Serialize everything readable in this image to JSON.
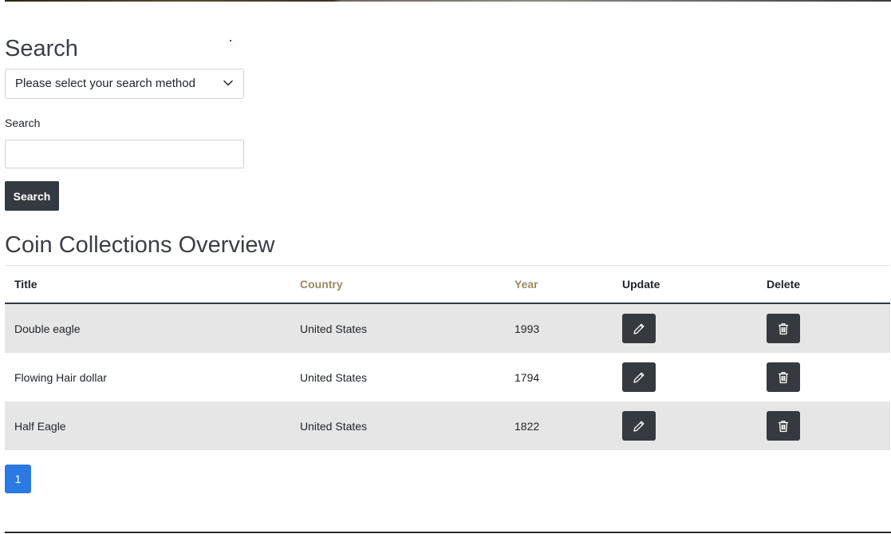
{
  "search_section": {
    "heading": "Search",
    "method_select_value": "Please select your search method",
    "search_label": "Search",
    "search_input_value": "",
    "search_button_label": "Search"
  },
  "overview": {
    "heading": "Coin Collections Overview",
    "columns": [
      "Title",
      "Country",
      "Year",
      "Update",
      "Delete"
    ],
    "rows": [
      {
        "title": "Double eagle",
        "country": "United States",
        "year": "1993"
      },
      {
        "title": "Flowing Hair dollar",
        "country": "United States",
        "year": "1794"
      },
      {
        "title": "Half Eagle",
        "country": "United States",
        "year": "1822"
      }
    ]
  },
  "pagination": {
    "current_page": "1"
  },
  "colors": {
    "dark_button": "#343a40",
    "sortable_header": "#9b8a63",
    "row_stripe": "#e6e6e6",
    "page_active": "#2a7ae2"
  },
  "icons": {
    "update": "pencil-icon",
    "delete": "trash-icon",
    "select_arrow": "chevron-down-icon"
  }
}
